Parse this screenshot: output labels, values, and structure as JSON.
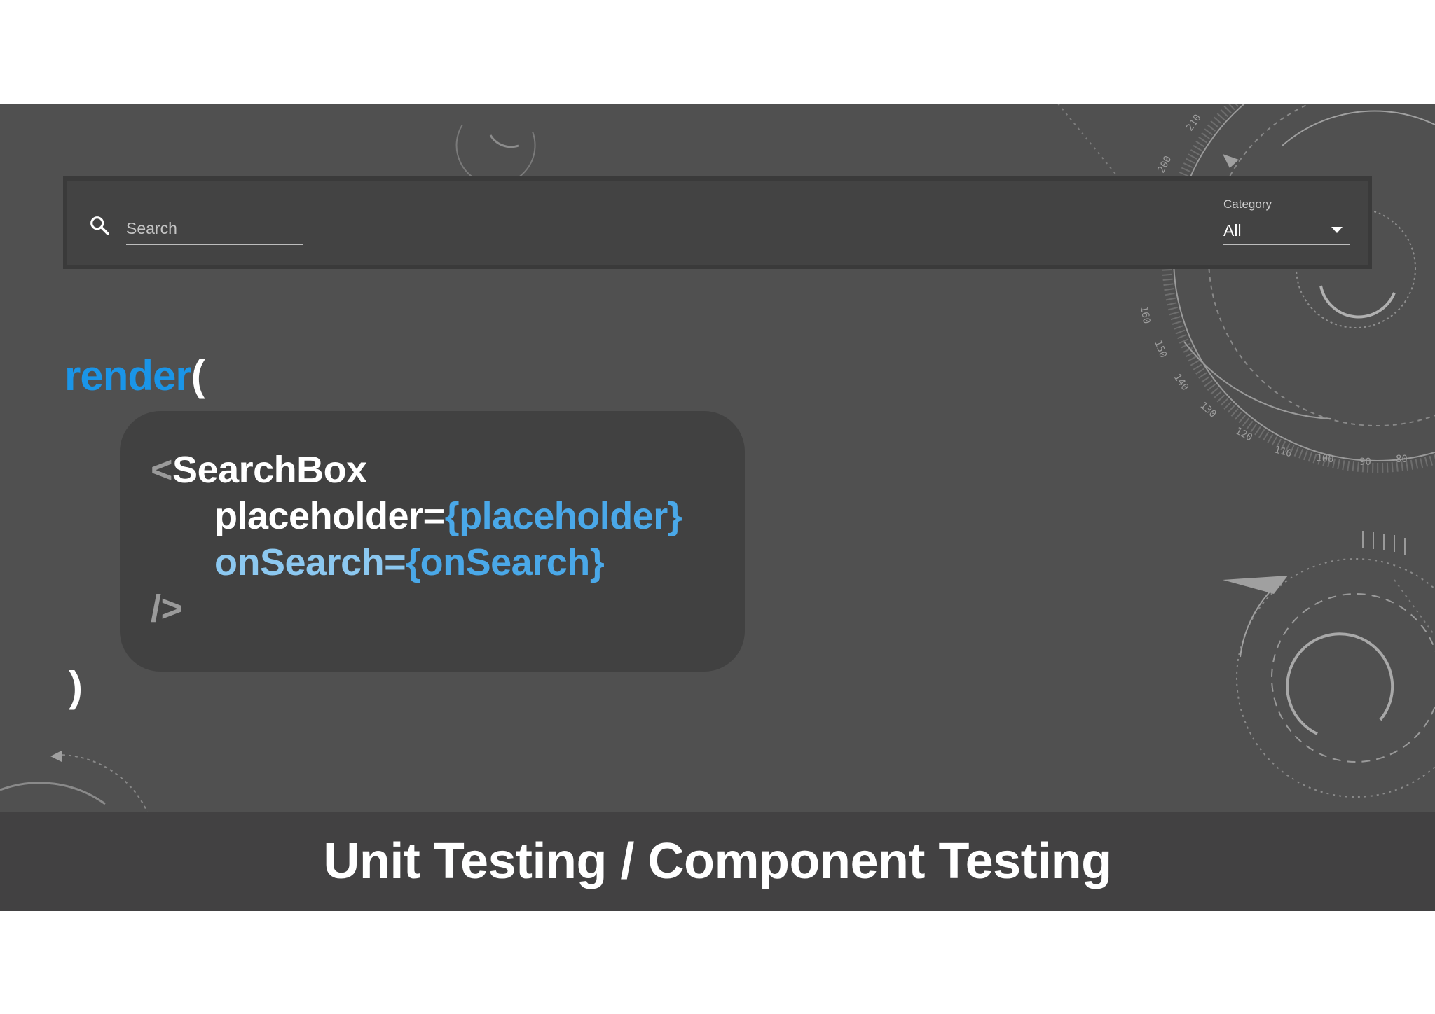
{
  "toolbar": {
    "search_placeholder": "Search",
    "category_label": "Category",
    "category_value": "All"
  },
  "code": {
    "render_fn": "render",
    "open_paren": "(",
    "tag_open_bracket": "<",
    "tag_name": "SearchBox",
    "prop1_name": "placeholder=",
    "prop1_value": "{placeholder}",
    "prop2_name": "onSearch=",
    "prop2_value": "{onSearch}",
    "tag_close": "/>",
    "close_paren": ")"
  },
  "dial_numbers": [
    "200",
    "210",
    "100",
    "160",
    "150",
    "140",
    "130",
    "120",
    "110",
    "100",
    "90",
    "80"
  ],
  "caption": "Unit Testing / Component Testing",
  "colors": {
    "slide_bg": "#505050",
    "code_box_bg": "#414141",
    "render_blue": "#1a95e8",
    "value_blue": "#4aa8e8",
    "name_light_blue": "#8cc8f0",
    "bracket_gray": "#9a9a9a"
  }
}
